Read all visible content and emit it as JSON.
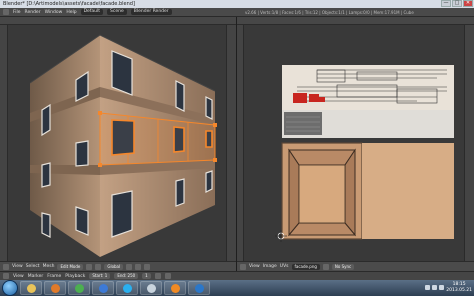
{
  "window": {
    "title": "Blender* [D:\\Artimodels\\assets\\facade\\facade.blend]",
    "minimize": "—",
    "maximize": "□",
    "close": "✕"
  },
  "info_header": {
    "menus": [
      "File",
      "Render",
      "Window",
      "Help"
    ],
    "layout": "Default",
    "scene": "Scene",
    "engine": "Blender Render",
    "stats": "v2.66 | Verts:1/8 | Faces:1/6 | Tris:12 | Objects:1/1 | Lamps:0/0 | Mem:17.91M | Cube"
  },
  "viewport_bottom": {
    "menus": [
      "View",
      "Select",
      "Mesh"
    ],
    "mode": "Edit Mode",
    "shading": "Global"
  },
  "uv_bottom": {
    "menus": [
      "View",
      "Image",
      "UVs"
    ],
    "image": "facade.png",
    "sync": "No Sync"
  },
  "timeline": {
    "menus": [
      "View",
      "Marker",
      "Frame",
      "Playback"
    ],
    "start_label": "Start: 1",
    "end_label": "End: 250",
    "frame": "1"
  },
  "taskbar": {
    "apps": [
      {
        "name": "explorer",
        "color": "#e8c35a"
      },
      {
        "name": "firefox",
        "color": "#e07a2a"
      },
      {
        "name": "chrome",
        "color": "#4caf50"
      },
      {
        "name": "media",
        "color": "#3d7ad6"
      },
      {
        "name": "skype",
        "color": "#2ab0ef"
      },
      {
        "name": "steam",
        "color": "#c8d3dd"
      },
      {
        "name": "blender",
        "color": "#f08a24"
      },
      {
        "name": "photoshop",
        "color": "#2b77c9"
      }
    ],
    "time": "18:15",
    "date": "2013.05.21"
  },
  "colors": {
    "selection": "#f5872b",
    "wall": "#a9896f",
    "floor_band": "#8a6c55"
  }
}
